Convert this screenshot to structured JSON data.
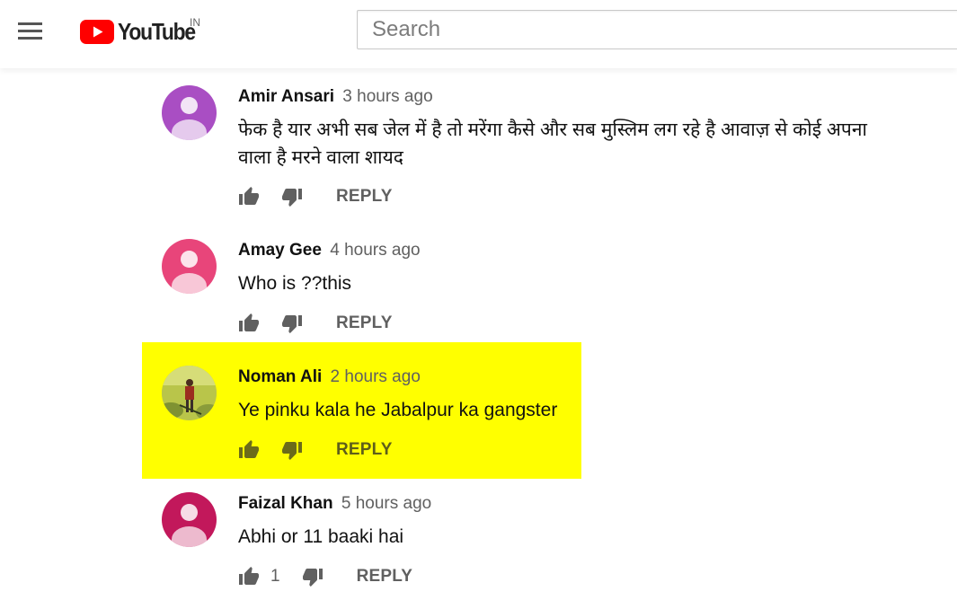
{
  "header": {
    "menu_icon": "hamburger-menu-icon",
    "logo_text": "YouTube",
    "logo_country": "IN",
    "search_placeholder": "Search"
  },
  "colors": {
    "youtube_red": "#ff0000",
    "highlight": "#ffff00",
    "meta_gray": "#606060",
    "icon_gray": "#606060"
  },
  "comments": [
    {
      "author": "Amir Ansari",
      "time": "3 hours ago",
      "text": "फेक है यार अभी सब जेल में है तो मरेंगा कैसे और सब मुस्लिम लग रहे है आवाज़ से कोई अपना वाला है मरने वाला शायद",
      "likes": "",
      "reply_label": "REPLY",
      "avatar_color": "#a94ec3"
    },
    {
      "author": "Amay Gee",
      "time": "4 hours ago",
      "text": "Who is ??this",
      "likes": "",
      "reply_label": "REPLY",
      "avatar_color": "#e8457a"
    },
    {
      "author": "Noman Ali",
      "time": "2 hours ago",
      "text": "Ye pinku kala he Jabalpur ka gangster",
      "likes": "",
      "reply_label": "REPLY",
      "highlighted": true
    },
    {
      "author": "Faizal Khan",
      "time": "5 hours ago",
      "text": "Abhi or 11 baaki hai",
      "likes": "1",
      "reply_label": "REPLY",
      "avatar_color": "#c2185b"
    }
  ]
}
